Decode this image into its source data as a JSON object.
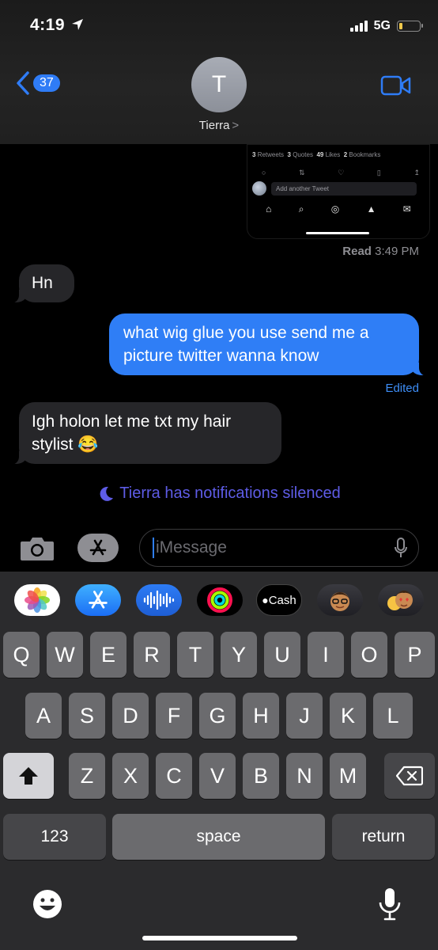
{
  "status_bar": {
    "time": "4:19",
    "network": "5G",
    "battery_level": 0.15
  },
  "header": {
    "back_badge": "37",
    "avatar_initial": "T",
    "contact_name": "Tierra",
    "contact_chevron": ">"
  },
  "embedded_tweet": {
    "stats": [
      {
        "count": "3",
        "label": "Retweets"
      },
      {
        "count": "3",
        "label": "Quotes"
      },
      {
        "count": "49",
        "label": "Likes"
      },
      {
        "count": "2",
        "label": "Bookmarks"
      }
    ],
    "reply_placeholder": "Add another Tweet"
  },
  "read_receipt": {
    "label": "Read",
    "time": "3:49 PM"
  },
  "messages": [
    {
      "direction": "received",
      "text": "Hn"
    },
    {
      "direction": "sent",
      "text": "what wig glue you use send me a picture twitter wanna know"
    },
    {
      "direction": "received",
      "text": "Igh holon let me txt my hair stylist 😂"
    }
  ],
  "edited_label": "Edited",
  "silenced_notice": "Tierra has notifications silenced",
  "compose": {
    "placeholder": "iMessage"
  },
  "app_drawer": [
    {
      "name": "photos"
    },
    {
      "name": "app-store"
    },
    {
      "name": "audio-message"
    },
    {
      "name": "activity"
    },
    {
      "name": "apple-cash",
      "label": "Cash"
    },
    {
      "name": "memoji"
    },
    {
      "name": "memoji-stickers"
    }
  ],
  "keyboard": {
    "row1": [
      "Q",
      "W",
      "E",
      "R",
      "T",
      "Y",
      "U",
      "I",
      "O",
      "P"
    ],
    "row2": [
      "A",
      "S",
      "D",
      "F",
      "G",
      "H",
      "J",
      "K",
      "L"
    ],
    "row3": [
      "Z",
      "X",
      "C",
      "V",
      "B",
      "N",
      "M"
    ],
    "numbers_key": "123",
    "space_key": "space",
    "return_key": "return"
  },
  "colors": {
    "sent_bubble": "#2f7ef6",
    "received_bubble": "#262629",
    "silenced_text": "#5e5ce6"
  }
}
